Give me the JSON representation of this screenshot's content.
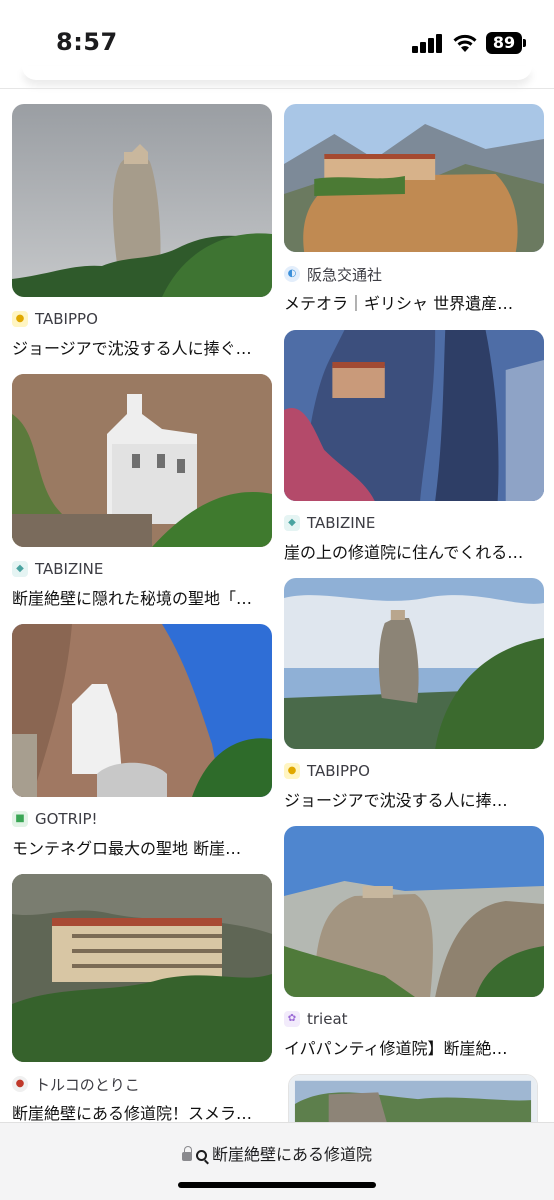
{
  "status": {
    "time": "8:57",
    "battery": "89"
  },
  "results": {
    "left": [
      {
        "source": "TABIPPO",
        "icon": "tabippo-icon",
        "caption": "ジョージアで沈没する人に捧ぐ…"
      },
      {
        "source": "TABIZINE",
        "icon": "tabizine-icon",
        "caption": "断崖絶壁に隠れた秘境の聖地「…"
      },
      {
        "source": "GOTRIP!",
        "icon": "gotrip-icon",
        "caption": "モンテネグロ最大の聖地 断崖…"
      },
      {
        "source": "トルコのとりこ",
        "icon": "torukonotoriko-icon",
        "caption": "断崖絶壁にある修道院！スメラ…"
      }
    ],
    "right": [
      {
        "source": "阪急交通社",
        "icon": "hankyu-icon",
        "caption": "メテオラ｜ギリシャ 世界遺産…"
      },
      {
        "source": "TABIZINE",
        "icon": "tabizine-icon",
        "caption": "崖の上の修道院に住んでくれる…"
      },
      {
        "source": "TABIPPO",
        "icon": "tabippo-icon",
        "caption": "ジョージアで沈没する人に捧…"
      },
      {
        "source": "trieat",
        "icon": "trieat-icon",
        "caption": "イパパンティ修道院】断崖絶…"
      }
    ]
  },
  "address_bar": {
    "url_text": "断崖絶壁にある修道院"
  },
  "colors": {
    "tabippo": "#f2c200",
    "tabizine": "#4aa3a0",
    "gotrip": "#3aa655",
    "hankyu": "#3b8fd9",
    "trieat": "#9b6bd6"
  }
}
